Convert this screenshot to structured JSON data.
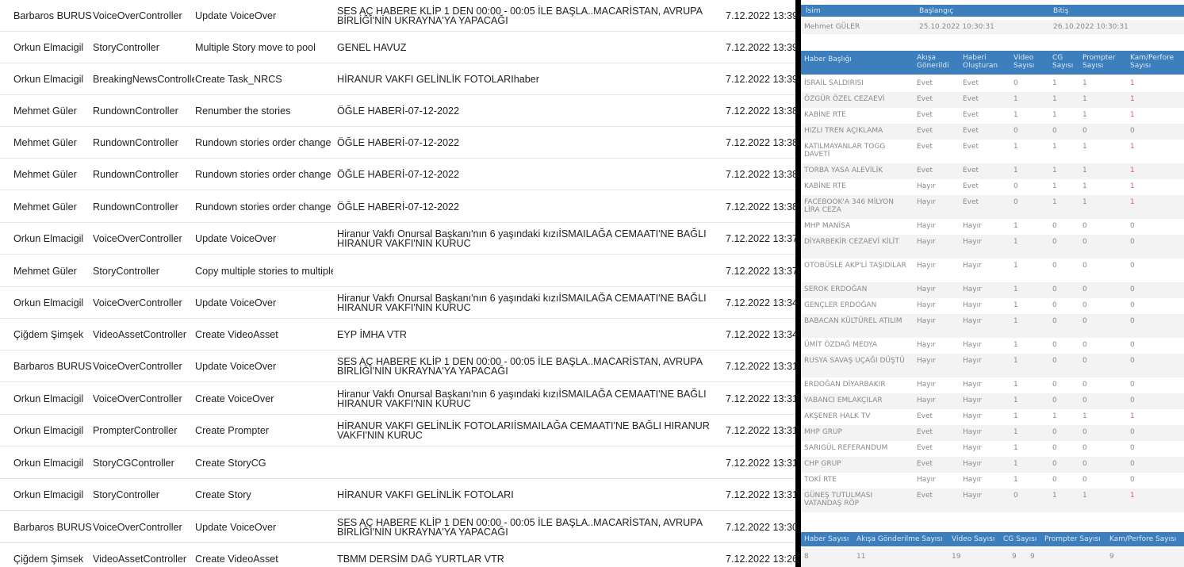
{
  "log_rows": [
    {
      "user": "Barbaros BURUS",
      "controller": "VoiceOverController",
      "action": "Update VoiceOver",
      "title": "SES AÇ HABERE KLİP 1 DEN 00:00 - 00:05 İLE BAŞLA..MACARİSTAN, AVRUPA BİRLİĞİ'NİN UKRAYNA'YA YAPACAĞI",
      "date": "7.12.2022 13:39"
    },
    {
      "user": "Orkun Elmacigil",
      "controller": "StoryController",
      "action": "Multiple Story move to pool",
      "title": "GENEL HAVUZ",
      "date": "7.12.2022 13:39"
    },
    {
      "user": "Orkun Elmacigil",
      "controller": "BreakingNewsController",
      "action": "Create Task_NRCS",
      "title": "HİRANUR VAKFI GELİNLİK FOTOLARIhaber",
      "date": "7.12.2022 13:39"
    },
    {
      "user": "Mehmet Güler",
      "controller": "RundownController",
      "action": "Renumber the stories",
      "title": "ÖĞLE HABERİ-07-12-2022",
      "date": "7.12.2022 13:38"
    },
    {
      "user": "Mehmet Güler",
      "controller": "RundownController",
      "action": "Rundown stories order change",
      "title": "ÖĞLE HABERİ-07-12-2022",
      "date": "7.12.2022 13:38"
    },
    {
      "user": "Mehmet Güler",
      "controller": "RundownController",
      "action": "Rundown stories order change",
      "title": "ÖĞLE HABERİ-07-12-2022",
      "date": "7.12.2022 13:38"
    },
    {
      "user": "Mehmet Güler",
      "controller": "RundownController",
      "action": "Rundown stories order change",
      "title": "ÖĞLE HABERİ-07-12-2022",
      "date": "7.12.2022 13:38"
    },
    {
      "user": "Orkun Elmacigil",
      "controller": "VoiceOverController",
      "action": "Update VoiceOver",
      "title": "Hiranur Vakfı Onursal Başkanı'nın 6 yaşındaki kızıİSMAILAĞA CEMAATI'NE BAĞLI HIRANUR VAKFI'NIN KURUC",
      "date": "7.12.2022 13:37"
    },
    {
      "user": "Mehmet Güler",
      "controller": "StoryController",
      "action": "Copy multiple stories to multiple r",
      "title": "",
      "date": "7.12.2022 13:37"
    },
    {
      "user": "Orkun Elmacigil",
      "controller": "VoiceOverController",
      "action": "Update VoiceOver",
      "title": "Hiranur Vakfı Onursal Başkanı'nın 6 yaşındaki kızıİSMAILAĞA CEMAATI'NE BAĞLI HIRANUR VAKFI'NIN KURUC",
      "date": "7.12.2022 13:34"
    },
    {
      "user": "Çiğdem Şimşek",
      "controller": "VideoAssetController",
      "action": "Create VideoAsset",
      "title": "EYP İMHA VTR",
      "date": "7.12.2022 13:34"
    },
    {
      "user": "Barbaros BURUS",
      "controller": "VoiceOverController",
      "action": "Update VoiceOver",
      "title": "SES AÇ HABERE KLİP 1 DEN 00:00 - 00:05 İLE BAŞLA..MACARİSTAN, AVRUPA BİRLİĞİ'NİN UKRAYNA'YA YAPACAĞI",
      "date": "7.12.2022 13:31"
    },
    {
      "user": "Orkun Elmacigil",
      "controller": "VoiceOverController",
      "action": "Create VoiceOver",
      "title": "Hiranur Vakfı Onursal Başkanı'nın 6 yaşındaki kızıİSMAILAĞA CEMAATI'NE BAĞLI HIRANUR VAKFI'NIN KURUC",
      "date": "7.12.2022 13:31"
    },
    {
      "user": "Orkun Elmacigil",
      "controller": "PrompterController",
      "action": "Create Prompter",
      "title": "HİRANUR VAKFI GELİNLİK FOTOLARIİSMAILAĞA CEMAATI'NE BAĞLI HIRANUR VAKFI'NIN KURUC",
      "date": "7.12.2022 13:31"
    },
    {
      "user": "Orkun Elmacigil",
      "controller": "StoryCGController",
      "action": "Create StoryCG",
      "title": "",
      "date": "7.12.2022 13:31"
    },
    {
      "user": "Orkun Elmacigil",
      "controller": "StoryController",
      "action": "Create Story",
      "title": "HİRANUR VAKFI GELİNLİK FOTOLARI",
      "date": "7.12.2022 13:31"
    },
    {
      "user": "Barbaros BURUS",
      "controller": "VoiceOverController",
      "action": "Update VoiceOver",
      "title": "SES AÇ HABERE KLİP 1 DEN 00:00 - 00:05 İLE BAŞLA..MACARİSTAN, AVRUPA BİRLİĞİ'NİN UKRAYNA'YA YAPACAĞI",
      "date": "7.12.2022 13:30"
    },
    {
      "user": "Çiğdem Şimsek",
      "controller": "VideoAssetController",
      "action": "Create VideoAsset",
      "title": "TBMM DERSİM DAĞ YURTLAR VTR",
      "date": "7.12.2022 13:26"
    }
  ],
  "report": {
    "header": {
      "name": "İsim",
      "start": "Başlangıç",
      "end": "Bitiş"
    },
    "person": {
      "name": "Mehmet GÜLER",
      "start": "25.10.2022 10:30:31",
      "end": "26.10.2022 10:30:31"
    },
    "news_header": {
      "title": "Haber Başlığı",
      "sent": "Akışa Gönerildi",
      "created": "Haberi Oluşturan",
      "video": "Video Sayısı",
      "cg": "CG Sayısı",
      "prompter": "Prompter Sayısı",
      "cam": "Kam/Perfore Sayısı"
    },
    "news": [
      {
        "title": "İSRAİL SALDIRISI",
        "sent": "Evet",
        "created": "Evet",
        "video": "0",
        "cg": "1",
        "prompter": "1",
        "cam": "1"
      },
      {
        "title": " ÖZGÜR ÖZEL CEZAEVİ",
        "sent": "Evet",
        "created": "Evet",
        "video": "1",
        "cg": "1",
        "prompter": "1",
        "cam": "1"
      },
      {
        "title": " KABİNE RTE",
        "sent": "Evet",
        "created": "Evet",
        "video": "1",
        "cg": "1",
        "prompter": "1",
        "cam": "1"
      },
      {
        "title": "HIZLI TREN AÇIKLAMA",
        "sent": "Evet",
        "created": "Evet",
        "video": "0",
        "cg": "0",
        "prompter": "0",
        "cam": "0"
      },
      {
        "title": "KATILMAYANLAR TOGG DAVETİ",
        "sent": "Evet",
        "created": "Evet",
        "video": "1",
        "cg": "1",
        "prompter": "1",
        "cam": "1"
      },
      {
        "title": "TORBA YASA ALEVİLİK",
        "sent": "Evet",
        "created": "Evet",
        "video": "1",
        "cg": "1",
        "prompter": "1",
        "cam": "1"
      },
      {
        "title": "KABİNE RTE",
        "sent": "Hayır",
        "created": "Evet",
        "video": "0",
        "cg": "1",
        "prompter": "1",
        "cam": "1"
      },
      {
        "title": "FACEBOOK'A 346 MİLYON LİRA CEZA",
        "sent": "Hayır",
        "created": "Evet",
        "video": "0",
        "cg": "1",
        "prompter": "1",
        "cam": "1"
      },
      {
        "title": "MHP MANİSA",
        "sent": "Hayır",
        "created": "Hayır",
        "video": "1",
        "cg": "0",
        "prompter": "0",
        "cam": "0"
      },
      {
        "title": "  DİYARBEKİR CEZAEVİ KİLİT",
        "sent": "Hayır",
        "created": "Hayır",
        "video": "1",
        "cg": "0",
        "prompter": "0",
        "cam": "0"
      },
      {
        "title": "OTOBÜSLE AKP'Lİ TAŞIDILAR",
        "sent": "Hayır",
        "created": "Hayır",
        "video": "1",
        "cg": "0",
        "prompter": "0",
        "cam": "0"
      },
      {
        "title": "SEROK ERDOĞAN",
        "sent": "Hayır",
        "created": "Hayır",
        "video": "1",
        "cg": "0",
        "prompter": "0",
        "cam": "0"
      },
      {
        "title": "GENÇLER ERDOĞAN",
        "sent": "Hayır",
        "created": "Hayır",
        "video": "1",
        "cg": "0",
        "prompter": "0",
        "cam": "0"
      },
      {
        "title": "BABACAN KÜLTÜREL ATILIM",
        "sent": "Hayır",
        "created": "Hayır",
        "video": "1",
        "cg": "0",
        "prompter": "0",
        "cam": "0"
      },
      {
        "title": "ÜMİT ÖZDAĞ MEDYA",
        "sent": "Hayır",
        "created": "Hayır",
        "video": "1",
        "cg": "0",
        "prompter": "0",
        "cam": "0"
      },
      {
        "title": "RUSYA SAVAŞ UÇAĞI DÜŞTÜ",
        "sent": "Hayır",
        "created": "Hayır",
        "video": "1",
        "cg": "0",
        "prompter": "0",
        "cam": "0"
      },
      {
        "title": "ERDOĞAN DİYARBAKIR",
        "sent": "Hayır",
        "created": "Hayır",
        "video": "1",
        "cg": "0",
        "prompter": "0",
        "cam": "0"
      },
      {
        "title": "YABANCI EMLAKÇILAR",
        "sent": "Hayır",
        "created": "Hayır",
        "video": "1",
        "cg": "0",
        "prompter": "0",
        "cam": "0"
      },
      {
        "title": "AKŞENER HALK TV",
        "sent": "Evet",
        "created": "Hayır",
        "video": "1",
        "cg": "1",
        "prompter": "1",
        "cam": "1"
      },
      {
        "title": "MHP GRUP",
        "sent": "Evet",
        "created": "Hayır",
        "video": "1",
        "cg": "0",
        "prompter": "0",
        "cam": "0"
      },
      {
        "title": "SARIGÜL REFERANDUM",
        "sent": "Evet",
        "created": "Hayır",
        "video": "1",
        "cg": "0",
        "prompter": "0",
        "cam": "0"
      },
      {
        "title": "CHP GRUP",
        "sent": "Evet",
        "created": "Hayır",
        "video": "1",
        "cg": "0",
        "prompter": "0",
        "cam": "0"
      },
      {
        "title": "TOKİ RTE",
        "sent": "Hayır",
        "created": "Hayır",
        "video": "1",
        "cg": "0",
        "prompter": "0",
        "cam": "0"
      },
      {
        "title": "GÜNEŞ TUTULMASI VATANDAŞ RÖP",
        "sent": "Evet",
        "created": "Hayır",
        "video": "0",
        "cg": "1",
        "prompter": "1",
        "cam": "1"
      }
    ],
    "summary_header": {
      "count": "Haber Sayısı",
      "sent": "Akışa Gönderilme Sayısı",
      "video": "Video Sayısı",
      "cg": "CG Sayısı",
      "prompter": "Prompter Sayısı",
      "cam": "Kam/Perfore Sayısı"
    },
    "summary": {
      "count": "8",
      "sent": "11",
      "video": "19",
      "cg": "9",
      "prompter": "9",
      "cam": "9"
    }
  }
}
